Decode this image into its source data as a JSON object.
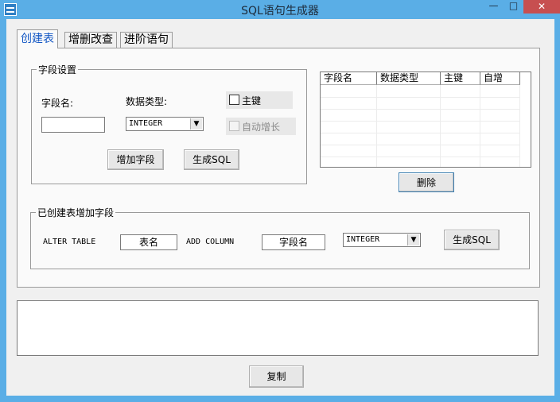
{
  "window": {
    "title": "SQL语句生成器",
    "min_symbol": "—",
    "max_symbol": "□",
    "close_symbol": "✕"
  },
  "tabs": [
    {
      "label": "创建表"
    },
    {
      "label": "增删改查"
    },
    {
      "label": "进阶语句"
    }
  ],
  "field_settings": {
    "legend": "字段设置",
    "field_name_label": "字段名:",
    "field_name_value": "",
    "data_type_label": "数据类型:",
    "data_type_value": "INTEGER",
    "primary_key_label": "主键",
    "auto_increment_label": "自动增长",
    "add_field_button": "增加字段",
    "generate_sql_button": "生成SQL"
  },
  "field_list": {
    "columns": [
      "字段名",
      "数据类型",
      "主键",
      "自增"
    ],
    "rows": []
  },
  "delete_button": "删除",
  "alter_section": {
    "legend": "已创建表增加字段",
    "alter_table_text": "ALTER TABLE",
    "table_name_value": "表名",
    "add_column_text": "ADD COLUMN",
    "field_name_value": "字段名",
    "data_type_value": "INTEGER",
    "generate_sql_button": "生成SQL"
  },
  "output": {
    "value": ""
  },
  "copy_button": "复制",
  "colors": {
    "titlebar": "#5aaee6",
    "close": "#c74f50",
    "active_tab_text": "#1357c4"
  }
}
